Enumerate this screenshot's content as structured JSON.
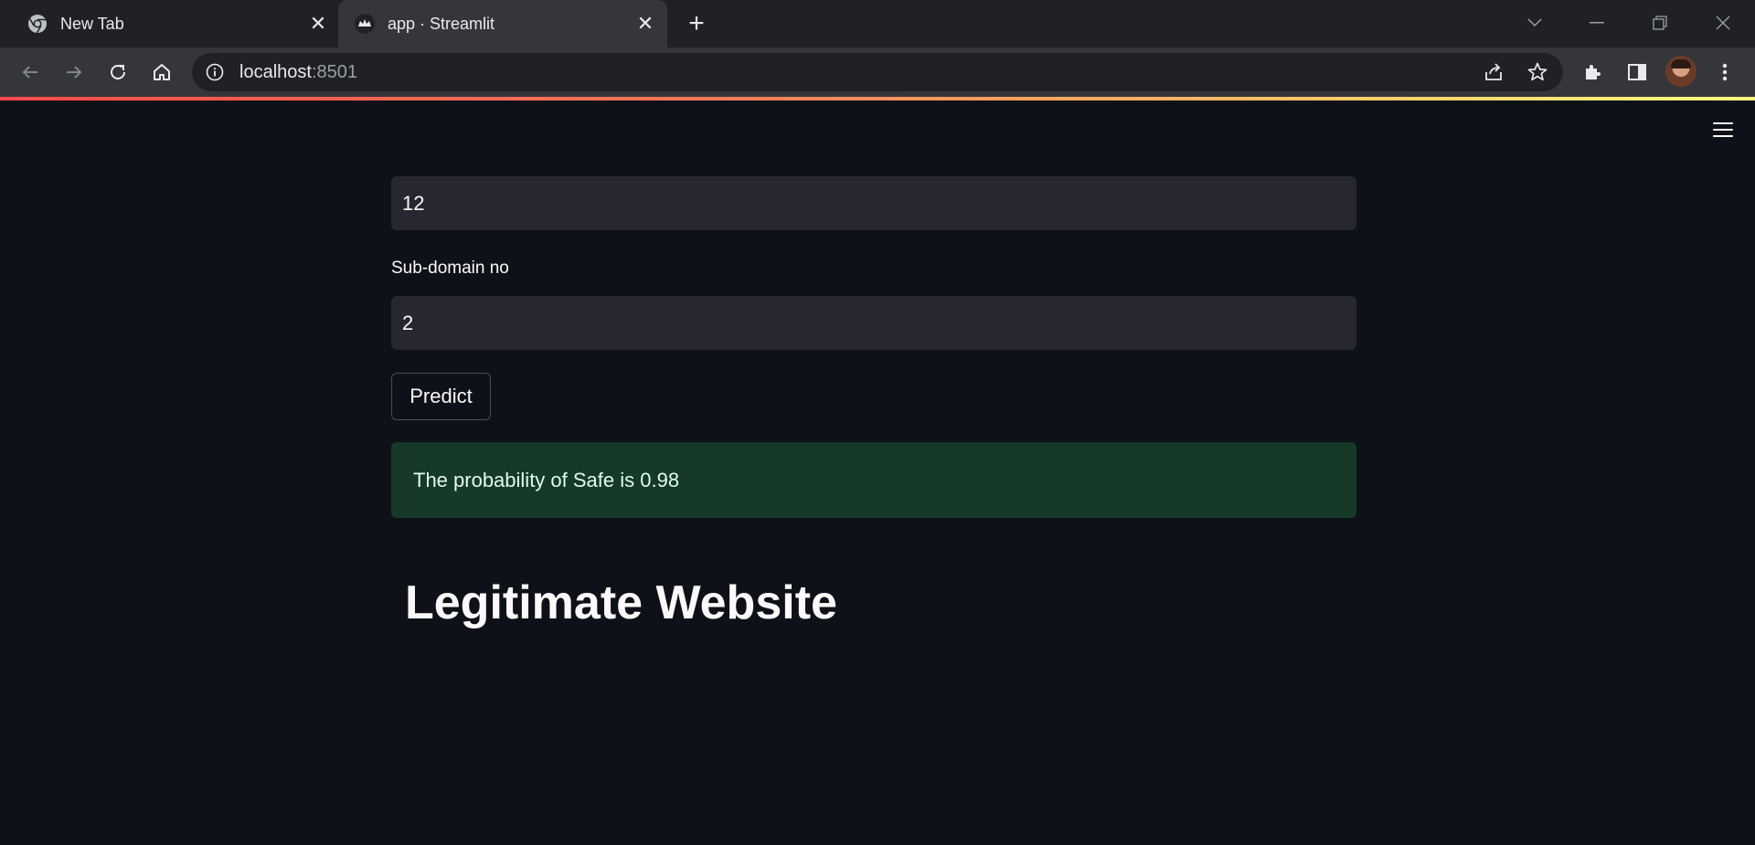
{
  "browser": {
    "tabs": [
      {
        "label": "New Tab",
        "icon": "chrome-icon",
        "active": false
      },
      {
        "label": "app · Streamlit",
        "icon": "streamlit-icon",
        "active": true
      }
    ],
    "url_host": "localhost",
    "url_port": ":8501"
  },
  "app": {
    "field_1_value": "12",
    "subdomain_label": "Sub-domain no",
    "subdomain_value": "2",
    "predict_label": "Predict",
    "result_message": "The probability of Safe is 0.98",
    "result_heading": "Legitimate Website"
  },
  "colors": {
    "background": "#0e1117",
    "input_bg": "#262730",
    "success_bg": "#173928",
    "accent_gradient_start": "#ff4b4b",
    "accent_gradient_end": "#fffd80"
  }
}
